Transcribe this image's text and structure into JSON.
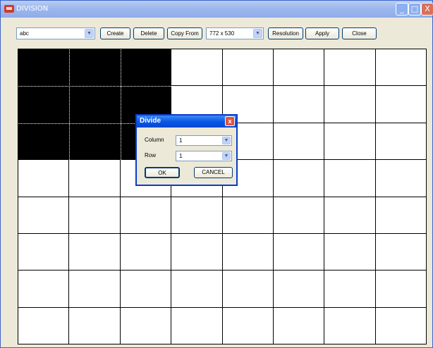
{
  "window": {
    "title": "DIVISION",
    "controls": {
      "minimize": "_",
      "maximize": "□",
      "close": "X"
    }
  },
  "toolbar": {
    "name_select_value": "abc",
    "create_label": "Create",
    "delete_label": "Delete",
    "copy_from_label": "Copy From",
    "resolution_select_value": "772 x 530",
    "resolution_label": "Resolution",
    "apply_label": "Apply",
    "close_label": "Close"
  },
  "grid": {
    "columns": 8,
    "rows": 8,
    "selected_cells": {
      "columns": 3,
      "rows": 3
    }
  },
  "dialog": {
    "title": "Divide",
    "close_glyph": "x",
    "column_label": "Column",
    "column_value": "1",
    "row_label": "Row",
    "row_value": "1",
    "ok_label": "OK",
    "cancel_label": "CANCEL"
  },
  "colors": {
    "titlebar": "#9db8ee",
    "dialog_titlebar": "#0a58e8",
    "window_bg": "#ece9d8",
    "selected_cells": "#000000"
  }
}
